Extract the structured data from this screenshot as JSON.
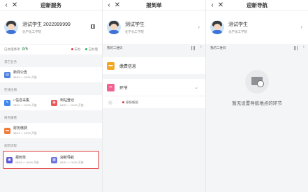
{
  "screen1": {
    "title": "迎新服务",
    "student_name": "测试学生 2022999999",
    "school": "化学化工学院",
    "stats_label": "已办理事项",
    "done": "0",
    "total": "/5",
    "legend": [
      {
        "label": "未办",
        "color": "#e03a3a"
      },
      {
        "label": "已办理",
        "color": "#2bb35a"
      }
    ],
    "sections": [
      {
        "title": "其它业务",
        "items": [
          {
            "name": "新闻公告",
            "date": "08/23 ～ 09/30 开放",
            "color": "#4a7fe0",
            "icon": "news-icon"
          }
        ]
      },
      {
        "title": "在线注册",
        "items": [
          {
            "name": "信息采集",
            "date": "08/22 ～ 09/30 开放",
            "color": "#3e88f0",
            "icon": "info-icon"
          },
          {
            "name": "到站登记",
            "date": "08/22 ～ 09/30 开放",
            "color": "#e85a5a",
            "icon": "train-icon"
          }
        ]
      },
      {
        "title": "财务缴费",
        "items": [
          {
            "name": "财务缴费",
            "date": "08/23 ～ 09/30 开放",
            "color": "#f07b3a",
            "icon": "wallet-icon"
          }
        ]
      },
      {
        "title": "迎新流程",
        "items": [
          {
            "name": "报到单",
            "date": "08/28 ～ 09/30 开放",
            "color": "#5a58d8",
            "icon": "report-icon"
          },
          {
            "name": "迎新导航",
            "date": "08/31 ～ 09/30 开放",
            "color": "#6d74e0",
            "icon": "nav-icon"
          }
        ]
      }
    ]
  },
  "screen2": {
    "title": "报到单",
    "student_name": "测试学生",
    "school": "化学化工学院",
    "qr_label": "我的二维码",
    "rows": [
      {
        "label": "缴费信息",
        "color": "#f5a623",
        "icon": "payment-icon"
      },
      {
        "label": "环节",
        "color": "#f06292",
        "icon": "link-icon"
      }
    ],
    "sub_label": "身份核验"
  },
  "screen3": {
    "title": "迎新导航",
    "student_name": "测试学生",
    "school": "化学化工学院",
    "qr_label": "我的二维码",
    "empty_text": "暂无设置导航地点的环节"
  },
  "nav": {
    "back": "‹",
    "close": "✕",
    "chev": "›",
    "chev_down": "⌄"
  }
}
